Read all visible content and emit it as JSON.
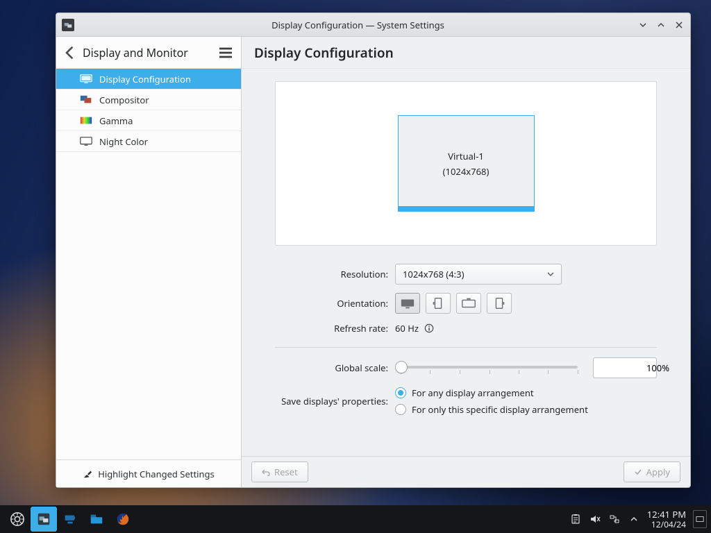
{
  "window": {
    "title": "Display Configuration — System Settings"
  },
  "sidebar": {
    "module_title": "Display and Monitor",
    "items": [
      {
        "label": "Display Configuration",
        "icon": "monitor"
      },
      {
        "label": "Compositor",
        "icon": "compositor"
      },
      {
        "label": "Gamma",
        "icon": "gamma"
      },
      {
        "label": "Night Color",
        "icon": "night"
      }
    ],
    "highlight_label": "Highlight Changed Settings"
  },
  "main": {
    "heading": "Display Configuration",
    "monitor": {
      "name": "Virtual-1",
      "res": "(1024x768)"
    },
    "labels": {
      "resolution": "Resolution:",
      "orientation": "Orientation:",
      "refresh": "Refresh rate:",
      "global_scale": "Global scale:",
      "save_props": "Save displays' properties:"
    },
    "resolution_value": "1024x768 (4:3)",
    "refresh_value": "60 Hz",
    "global_scale_value": "100%",
    "radios": {
      "any": "For any display arrangement",
      "specific": "For only this specific display arrangement"
    },
    "buttons": {
      "reset": "Reset",
      "apply": "Apply"
    }
  },
  "taskbar": {
    "time": "12:41 PM",
    "date": "12/04/24"
  }
}
